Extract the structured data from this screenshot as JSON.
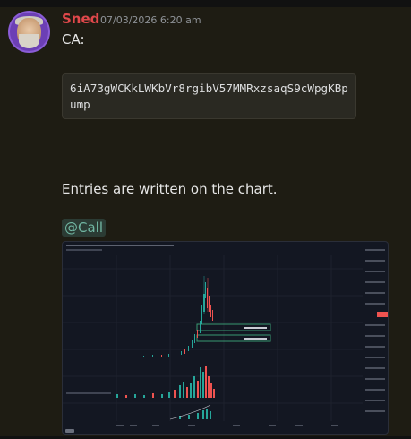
{
  "message": {
    "author": "Sned",
    "timestamp": "07/03/2026 6:20 am",
    "line1": "CA:",
    "contract_address": "6iA73gWCKkLWKbVr8rgibV57MMRxzsaqS9cWpgKBpump",
    "line2": "Entries are written on the chart.",
    "mention": "@Call"
  },
  "colors": {
    "username": "#e0484b",
    "mention_text": "#71b7a3",
    "candle_up": "#26a69a",
    "candle_down": "#ef5350"
  },
  "attachment": {
    "type": "trading-chart-screenshot",
    "icon": "tradingview-logo-icon"
  }
}
